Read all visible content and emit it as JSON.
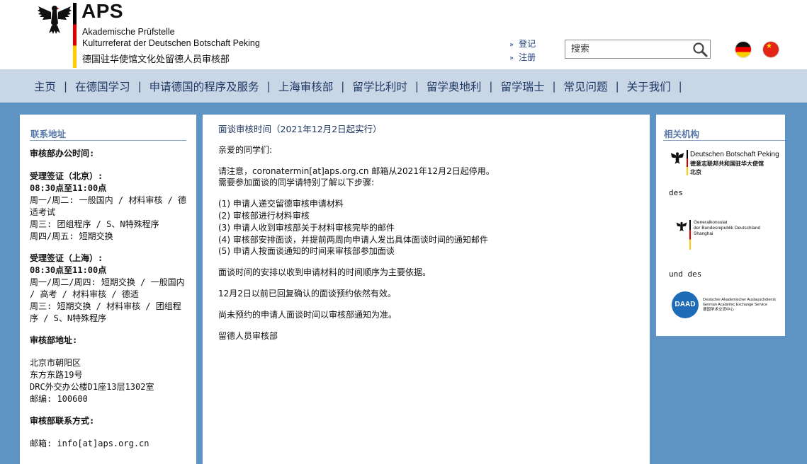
{
  "header": {
    "brand_name": "APS",
    "brand_line1": "Akademische Prüfstelle",
    "brand_line2": "Kulturreferat der Deutschen Botschaft Peking",
    "brand_line3": "德国驻华使馆文化处留德人员审核部",
    "login_label": "登记",
    "register_label": "注册",
    "search_placeholder": "搜索",
    "colors": {
      "brand_bar": [
        "#000000",
        "#dd0000",
        "#ffcc00"
      ]
    },
    "icons": [
      "eagle-emblem-icon",
      "search-icon",
      "germany-flag-icon",
      "china-flag-icon"
    ]
  },
  "nav": {
    "items": [
      {
        "label": "主页"
      },
      {
        "label": "在德国学习"
      },
      {
        "label": "申请德国的程序及服务"
      },
      {
        "label": "上海审核部"
      },
      {
        "label": "留学比利时"
      },
      {
        "label": "留学奥地利"
      },
      {
        "label": "留学瑞士"
      },
      {
        "label": "常见问题"
      },
      {
        "label": "关于我们"
      }
    ],
    "separator": "|"
  },
  "left": {
    "title": "联系地址",
    "office_hours_heading": "审核部办公时间:",
    "beijing": {
      "heading": "受理签证（北京）:",
      "hours": "08:30点至11:00点",
      "lines": [
        "周一/周二: 一般国内 / 材料审核 / 德适考试",
        "周三: 团组程序 / S、N特殊程序",
        "周四/周五: 短期交换"
      ]
    },
    "shanghai": {
      "heading": "受理签证（上海）:",
      "hours": "08:30点至11:00点",
      "lines": [
        "周一/周二/周四: 短期交换 / 一般国内 / 高考 / 材料审核 / 德适",
        "周三: 短期交换 / 材料审核 / 团组程序 / S、N特殊程序"
      ]
    },
    "address_heading": "审核部地址:",
    "address_lines": [
      "北京市朝阳区",
      "东方东路19号",
      "DRC外交办公楼D1座13层1302室",
      "邮编: 100600"
    ],
    "contact_heading": "审核部联系方式:",
    "email_line": "邮箱: info[at]aps.org.cn"
  },
  "main": {
    "title": "面谈审核时间（2021年12月2日起实行）",
    "greeting": "亲爱的同学们:",
    "para1_line1": "请注意，coronatermin[at]aps.org.cn 邮箱从2021年12月2日起停用。",
    "para1_line2": "需要参加面谈的同学请特别了解以下步骤:",
    "steps": [
      "(1) 申请人递交留德审核申请材料",
      "(2) 审核部进行材料审核",
      "(3) 申请人收到审核部关于材料审核完毕的邮件",
      "(4) 审核部安排面谈，并提前两周向申请人发出具体面谈时间的通知邮件",
      "(5) 申请人按面谈通知的时间来审核部参加面谈"
    ],
    "para2": "面谈时间的安排以收到申请材料的时间顺序为主要依据。",
    "para3": "12月2日以前已回复确认的面谈预约依然有效。",
    "para4": "尚未预约的申请人面谈时间以审核部通知为准。",
    "signature": "留德人员审核部"
  },
  "right": {
    "title": "相关机构",
    "embassy": {
      "line1": "Deutschen Botschaft Peking",
      "line2": "德意志联邦共和国驻华大使馆",
      "line3": "北京"
    },
    "conj1": "des",
    "consulate": {
      "line1": "Generalkonsulat",
      "line2": "der Bundesrepublik Deutschland",
      "line3": "Shanghai"
    },
    "conj2": "und des",
    "daad": {
      "badge": "DAAD",
      "line1": "Deutscher Akademischer Austauschdienst",
      "line2": "German Academic Exchange Service",
      "line3": "德国学术交流中心"
    }
  }
}
